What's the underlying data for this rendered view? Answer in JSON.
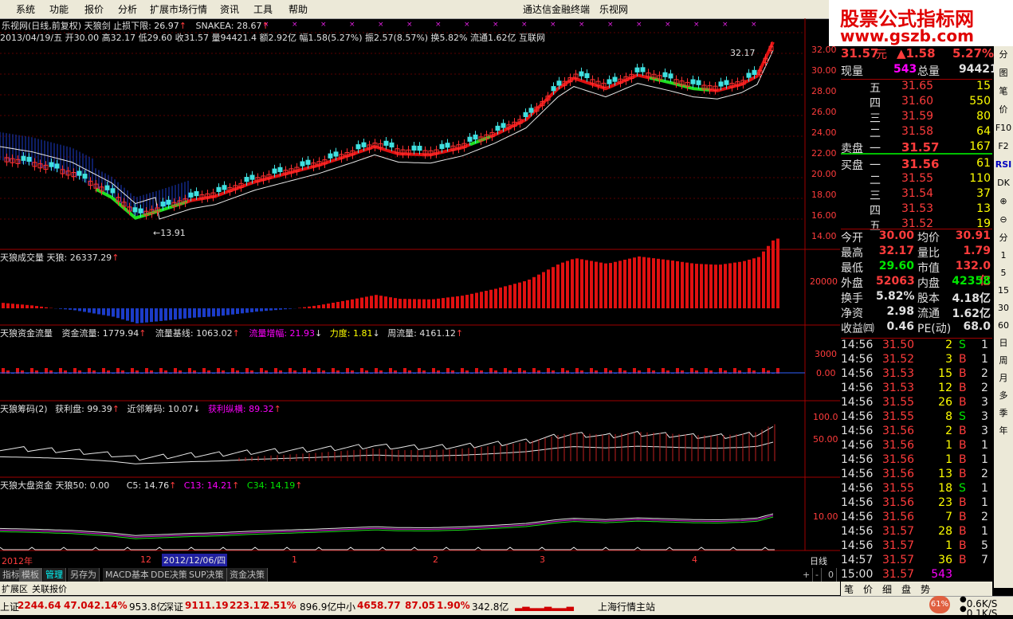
{
  "menu": [
    "系统",
    "功能",
    "报价",
    "分析",
    "扩展市场行情",
    "资讯",
    "工具",
    "帮助"
  ],
  "window_title": "通达信金融终端",
  "window_brand": "乐视网",
  "logo": {
    "line1": "股票公式指标网",
    "line2": "www.gszb.com"
  },
  "main": {
    "title": "乐视网(日线,前复权)",
    "indicator": "天狼剑",
    "stop_label": "止损下限: 26.97",
    "snake": "SNAKEA: 28.67",
    "ohlc": "2013/04/19/五 开30.00 高32.17 低29.60 收31.57 量94421.4 额2.92亿 幅1.58(5.27%) 振2.57(8.57%) 换5.82% 流通1.62亿 互联网",
    "high_mark": "32.17",
    "low_mark": "13.91",
    "y_ticks": [
      "32.00",
      "30.00",
      "28.00",
      "26.00",
      "24.00",
      "22.00",
      "20.00",
      "18.00",
      "16.00",
      "14.00"
    ]
  },
  "vol_panel": {
    "title": "天狼成交量 天狼: 26337.29",
    "tick": "20000"
  },
  "flow_panel": {
    "title": "天狼资金流量",
    "v1": "资金流量: 1779.94",
    "v2": "流量基线: 1063.02",
    "v3": "流量增幅: 21.93",
    "v4": "力度: 1.81",
    "v5": "周流量: 4161.12",
    "ticks": [
      "3000",
      "0.00"
    ]
  },
  "chip_panel": {
    "title": "天狼筹码(2)",
    "v1": "获利盘: 99.39",
    "v2": "近邻筹码: 10.07",
    "v3": "获利纵横: 89.32",
    "ticks": [
      "100.0",
      "50.00"
    ]
  },
  "market_panel": {
    "title": "天狼大盘资金 天狼50: 0.00",
    "c5": "C5: 14.76",
    "c13": "C13: 14.21",
    "c34": "C34: 14.19",
    "tick": "10.00"
  },
  "x_axis": {
    "labels": [
      "2012年",
      "12",
      "2012/12/06/四",
      "1",
      "2",
      "3",
      "4"
    ],
    "period": "日线"
  },
  "bottom_tabs": [
    "指标",
    "模板",
    "管理",
    "另存为",
    "MACD基本",
    "DDE决策",
    "SUP决策",
    "资金决策"
  ],
  "bottom_tabs2": [
    "扩展区",
    "关联报价"
  ],
  "quote": {
    "price": "31.57",
    "unit": "元",
    "change": "▲1.58",
    "pct": "5.27%",
    "now_vol_label": "现量",
    "now_vol": "543",
    "total_vol_label": "总量",
    "total_vol": "94421",
    "asks": [
      [
        "五",
        "31.65",
        "15"
      ],
      [
        "四",
        "31.60",
        "550"
      ],
      [
        "三",
        "31.59",
        "80"
      ],
      [
        "二",
        "31.58",
        "64"
      ],
      [
        "一",
        "31.57",
        "167"
      ]
    ],
    "bids": [
      [
        "一",
        "31.56",
        "61"
      ],
      [
        "二",
        "31.55",
        "110"
      ],
      [
        "三",
        "31.54",
        "37"
      ],
      [
        "四",
        "31.53",
        "13"
      ],
      [
        "五",
        "31.52",
        "19"
      ]
    ],
    "sell_label": "卖盘",
    "buy_label": "买盘",
    "stats": [
      [
        "今开",
        "30.00",
        "均价",
        "30.91"
      ],
      [
        "最高",
        "32.17",
        "量比",
        "1.79"
      ],
      [
        "最低",
        "29.60",
        "市值",
        "132.0亿"
      ],
      [
        "外盘",
        "52063",
        "内盘",
        "42358"
      ],
      [
        "换手",
        "5.82%",
        "股本",
        "4.18亿"
      ],
      [
        "净资",
        "2.98",
        "流通",
        "1.62亿"
      ],
      [
        "收益㈣",
        "0.46",
        "PE(动)",
        "68.0"
      ]
    ],
    "ticks": [
      [
        "14:56",
        "31.50",
        "2",
        "S"
      ],
      [
        "14:56",
        "31.52",
        "3",
        "B"
      ],
      [
        "14:56",
        "31.53",
        "15",
        "B"
      ],
      [
        "14:56",
        "31.53",
        "12",
        "B"
      ],
      [
        "14:56",
        "31.55",
        "26",
        "B"
      ],
      [
        "14:56",
        "31.55",
        "8",
        "S"
      ],
      [
        "14:56",
        "31.56",
        "2",
        "B"
      ],
      [
        "14:56",
        "31.56",
        "1",
        "B"
      ],
      [
        "14:56",
        "31.56",
        "1",
        "B"
      ],
      [
        "14:56",
        "31.56",
        "13",
        "B"
      ],
      [
        "14:56",
        "31.55",
        "18",
        "S"
      ],
      [
        "14:56",
        "31.56",
        "23",
        "B"
      ],
      [
        "14:56",
        "31.56",
        "7",
        "B"
      ],
      [
        "14:56",
        "31.57",
        "28",
        "B"
      ],
      [
        "14:56",
        "31.57",
        "1",
        "B"
      ],
      [
        "14:57",
        "31.57",
        "36",
        "B"
      ],
      [
        "15:00",
        "31.57",
        "543",
        ""
      ]
    ],
    "tick_counts": [
      "1",
      "1",
      "2",
      "2",
      "3",
      "3",
      "3",
      "1",
      "1",
      "2",
      "1",
      "1",
      "2",
      "1",
      "5",
      "7",
      ""
    ]
  },
  "right_tools": [
    "分",
    "图",
    "笔",
    "价",
    "F10",
    "F2",
    "RSI",
    "DK",
    "⊕",
    "⊖",
    "分",
    "1",
    "5",
    "15",
    "30",
    "60",
    "日",
    "周",
    "月",
    "多",
    "季",
    "年"
  ],
  "side_tabs": [
    "笔",
    "价",
    "细",
    "盘",
    "势"
  ],
  "status": {
    "sh_label": "上证",
    "sh_val": "2244.64",
    "sh_chg": "47.04",
    "sh_pct": "2.14%",
    "sh_amt": "953.8亿",
    "sz_label": "深证",
    "sz_val": "9111.19",
    "sz_chg": "223.17",
    "sz_pct": "2.51%",
    "sz_amt": "896.9亿",
    "zx_label": "中小",
    "zx_val": "4658.77",
    "zx_chg": "87.05",
    "zx_pct": "1.90%",
    "zx_amt": "342.8亿",
    "station": "上海行情主站",
    "cpu": "61%",
    "up": "0.6K/S",
    "down": "0.1K/S"
  }
}
